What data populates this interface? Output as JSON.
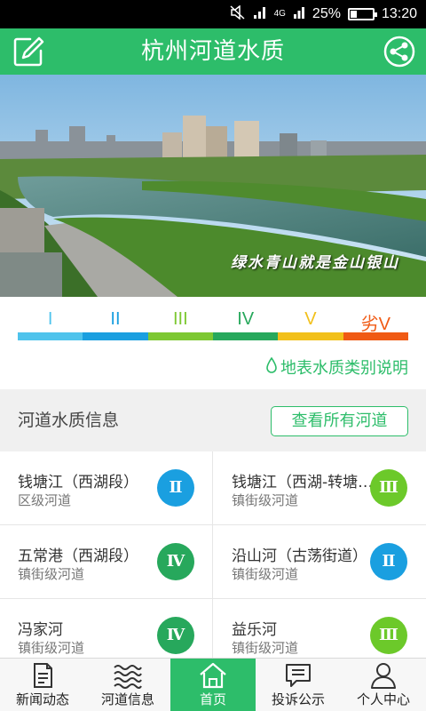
{
  "status_bar": {
    "network": "4G",
    "battery": "25%",
    "battery_level": 0.25,
    "time": "13:20"
  },
  "header": {
    "title": "杭州河道水质",
    "left_icon": "edit-icon",
    "right_icon": "share-icon",
    "color": "#2dbd6a"
  },
  "banner": {
    "caption": "绿水青山就是金山银山"
  },
  "legend": {
    "classes": [
      {
        "label": "I",
        "color": "#4fc3ec"
      },
      {
        "label": "II",
        "color": "#1a9fe0"
      },
      {
        "label": "III",
        "color": "#7dc832"
      },
      {
        "label": "IV",
        "color": "#27a85c"
      },
      {
        "label": "V",
        "color": "#f2c01a"
      },
      {
        "label": "劣V",
        "color": "#f05a14"
      }
    ],
    "explain_icon": "water-drop-icon",
    "explain_link": "地表水质类别说明"
  },
  "rivers_section": {
    "title": "河道水质信息",
    "view_all": "查看所有河道"
  },
  "rivers": [
    {
      "name": "钱塘江（西湖段）",
      "level": "区级河道",
      "grade": "Ⅱ",
      "color": "#1a9fe0"
    },
    {
      "name": "钱塘江（西湖-转塘段）",
      "level": "镇街级河道",
      "grade": "Ⅲ",
      "color": "#6cc92a"
    },
    {
      "name": "五常港（西湖段）",
      "level": "镇街级河道",
      "grade": "Ⅳ",
      "color": "#27a85c"
    },
    {
      "name": "沿山河（古荡街道）",
      "level": "镇街级河道",
      "grade": "Ⅱ",
      "color": "#1a9fe0"
    },
    {
      "name": "冯家河",
      "level": "镇街级河道",
      "grade": "Ⅳ",
      "color": "#27a85c"
    },
    {
      "name": "益乐河",
      "level": "镇街级河道",
      "grade": "Ⅲ",
      "color": "#6cc92a"
    }
  ],
  "bottom_nav": [
    {
      "label": "新闻动态",
      "icon": "news-icon",
      "active": false
    },
    {
      "label": "河道信息",
      "icon": "river-waves-icon",
      "active": false
    },
    {
      "label": "首页",
      "icon": "home-icon",
      "active": true
    },
    {
      "label": "投诉公示",
      "icon": "complaint-message-icon",
      "active": false
    },
    {
      "label": "个人中心",
      "icon": "user-icon",
      "active": false
    }
  ]
}
